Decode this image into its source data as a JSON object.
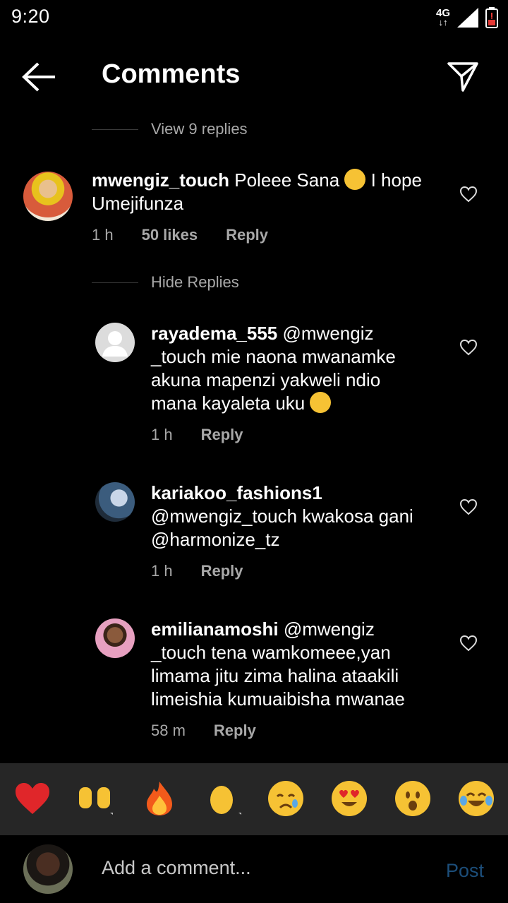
{
  "status_bar": {
    "time": "9:20",
    "network": "4G"
  },
  "header": {
    "title": "Comments"
  },
  "toggles": {
    "view_replies": "View 9 replies",
    "hide_replies": "Hide Replies"
  },
  "comments": [
    {
      "username": "mwengiz_touch",
      "text_before_emoji": "Poleee Sana",
      "text_after_emoji_line1": " I hope",
      "text_line2": "Umejifunza",
      "time": "1 h",
      "likes": "50 likes",
      "reply": "Reply"
    },
    {
      "username": "rayadema_555",
      "line1": " @mwengiz",
      "line2": "_touch mie naona mwanamke",
      "line3": "akuna mapenzi yakweli ndio",
      "line4": "mana kayaleta uku",
      "time": "1 h",
      "reply": "Reply"
    },
    {
      "username": "kariakoo_fashions1",
      "line2": "@mwengiz_touch kwakosa gani",
      "line3": "@harmonize_tz",
      "time": "1 h",
      "reply": "Reply"
    },
    {
      "username": "emilianamoshi",
      "line1": " @mwengiz",
      "line2": "_touch tena wamkomeee,yan",
      "line3": "limama jitu zima halina ataakili",
      "line4": "limeishia kumuaibisha mwanae",
      "time": "58 m",
      "reply": "Reply"
    }
  ],
  "reactions": [
    "red-heart",
    "raising-hands",
    "fire",
    "clapping-hands",
    "crying-face",
    "heart-eyes",
    "surprised-face",
    "tears-of-joy"
  ],
  "composer": {
    "placeholder": "Add a comment...",
    "post_label": "Post"
  },
  "colors": {
    "background": "#000000",
    "secondary_text": "#a8a8a8",
    "post_disabled": "#1c4e7a",
    "reaction_bar": "#262626"
  }
}
